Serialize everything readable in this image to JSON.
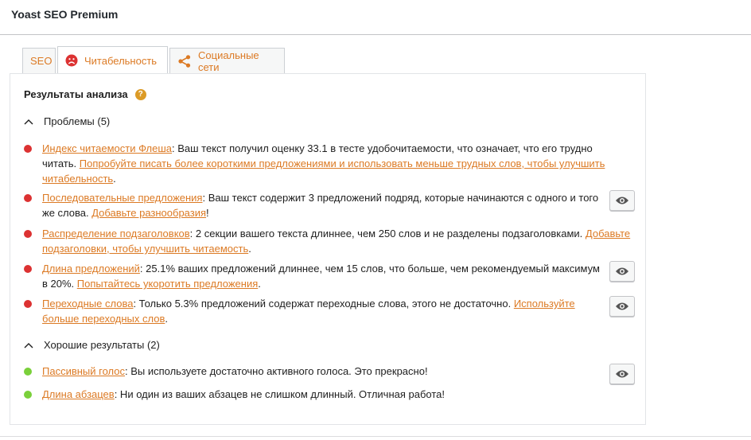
{
  "app": {
    "title": "Yoast SEO Premium"
  },
  "tabs": [
    {
      "label": "SEO"
    },
    {
      "label": "Читабельность"
    },
    {
      "label": "Социальные сети"
    }
  ],
  "analysis": {
    "heading": "Результаты анализа",
    "help_symbol": "?",
    "problems": {
      "label": "Проблемы (5)",
      "items": [
        {
          "title": "Индекс читаемости Флеша",
          "text": ": Ваш текст получил оценку 33.1 в тесте удобочитаемости, что означает, что его трудно читать. ",
          "link": "Попробуйте писать более короткими предложениями и использовать меньше трудных слов, чтобы улучшить читабельность",
          "tail": "."
        },
        {
          "title": "Последовательные предложения",
          "text": ": Ваш текст содержит 3 предложений подряд, которые начинаются с одного и того же слова. ",
          "link": "Добавьте разнообразия",
          "tail": "!"
        },
        {
          "title": "Распределение подзаголовков",
          "text": ": 2 секции вашего текста длиннее, чем 250 слов и не разделены подзаголовками. ",
          "link": "Добавьте подзаголовки, чтобы улучшить читаемость",
          "tail": "."
        },
        {
          "title": "Длина предложений",
          "text": ": 25.1% ваших предложений длиннее, чем 15 слов, что больше, чем рекомендуемый максимум в 20%. ",
          "link": "Попытайтесь укоротить предложения",
          "tail": "."
        },
        {
          "title": "Переходные слова",
          "text": ": Только 5.3% предложений содержат переходные слова, этого не достаточно. ",
          "link": "Используйте больше переходных слов",
          "tail": "."
        }
      ]
    },
    "good": {
      "label": "Хорошие результаты (2)",
      "items": [
        {
          "title": "Пассивный голос",
          "text": ": Вы используете достаточно активного голоса. Это прекрасно!"
        },
        {
          "title": "Длина абзацев",
          "text": ": Ни один из ваших абзацев не слишком длинный. Отличная работа!"
        }
      ]
    }
  },
  "colors": {
    "accent": "#dc7a24",
    "problem": "#dc3232",
    "good": "#7ad03a"
  }
}
